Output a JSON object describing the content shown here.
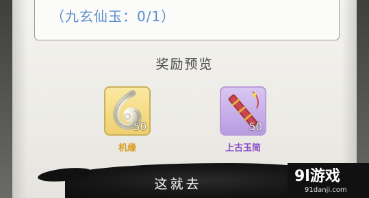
{
  "requirement": {
    "text": "（九玄仙玉：0/1）"
  },
  "rewards": {
    "title": "奖励预览",
    "items": [
      {
        "name": "机缘",
        "quantity": "50",
        "icon": "swirl-jade-icon",
        "rarity_color": "#d89a1a"
      },
      {
        "name": "上古玉简",
        "quantity": "50",
        "icon": "ancient-jade-scroll-icon",
        "rarity_color": "#8a4cc8"
      }
    ]
  },
  "action": {
    "label": "这就去"
  },
  "watermark": {
    "brand": "9l游戏",
    "url": "91danji.com"
  },
  "colors": {
    "requirement_text": "#5a8ccc",
    "panel": "#f4f3ef",
    "ink": "#111111"
  }
}
